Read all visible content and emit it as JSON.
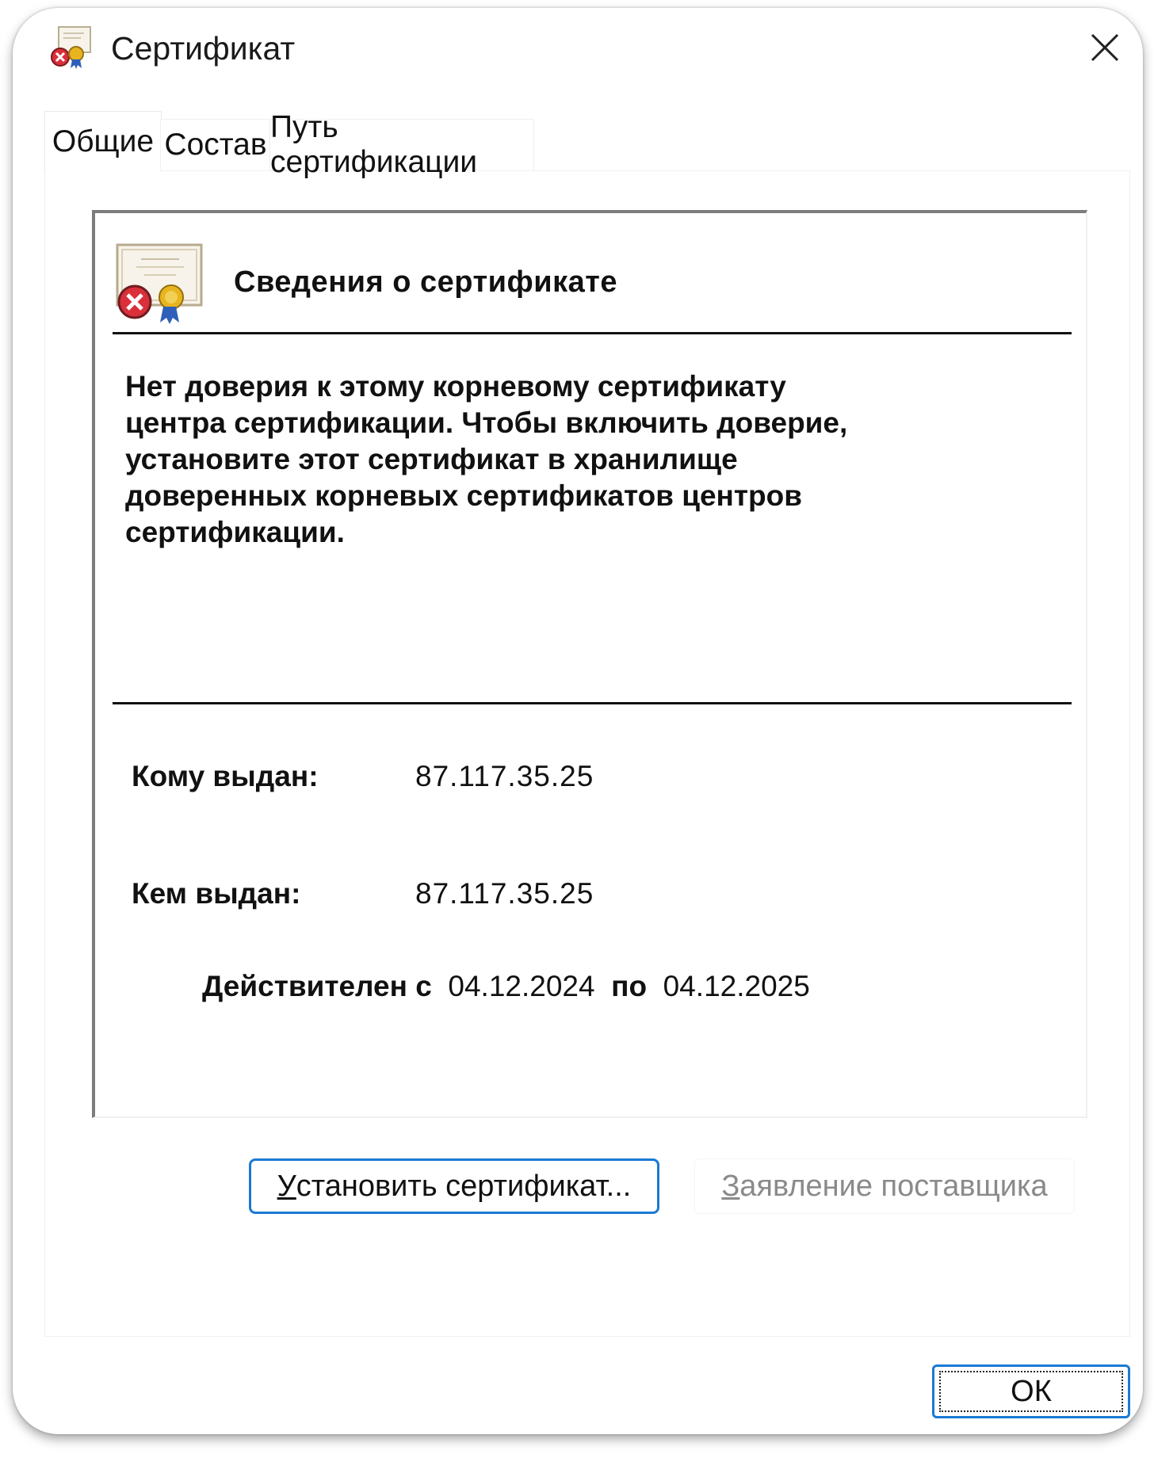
{
  "window": {
    "title": "Сертификат",
    "title_icon": "certificate-error-icon",
    "close_icon": "close-icon"
  },
  "tabs": [
    {
      "label": "Общие",
      "active": true
    },
    {
      "label": "Состав",
      "active": false
    },
    {
      "label": "Путь сертификации",
      "active": false
    }
  ],
  "info": {
    "icon": "certificate-untrusted-icon",
    "heading": "Сведения о сертификате",
    "warning_lines": [
      "Нет доверия к этому корневому сертификату",
      "центра сертификации. Чтобы включить  доверие,",
      "установите этот сертификат в хранилище",
      "доверенных корневых сертификатов центров",
      "сертификации."
    ],
    "issued_to_label": "Кому выдан:",
    "issued_to_value": "87.117.35.25",
    "issued_by_label": "Кем выдан:",
    "issued_by_value": "87.117.35.25",
    "valid_from_label": "Действителен с",
    "valid_from_value": "04.12.2024",
    "valid_to_label": "по",
    "valid_to_value": "04.12.2025"
  },
  "buttons": {
    "install_underlined": "У",
    "install_rest": "становить сертификат...",
    "vendor_underlined": "З",
    "vendor_rest": "аявление поставщика",
    "ok": "ОК"
  },
  "colors": {
    "focus_border": "#1a7ad4",
    "error_red": "#d9303a",
    "disabled_text": "#8a8a8a"
  }
}
